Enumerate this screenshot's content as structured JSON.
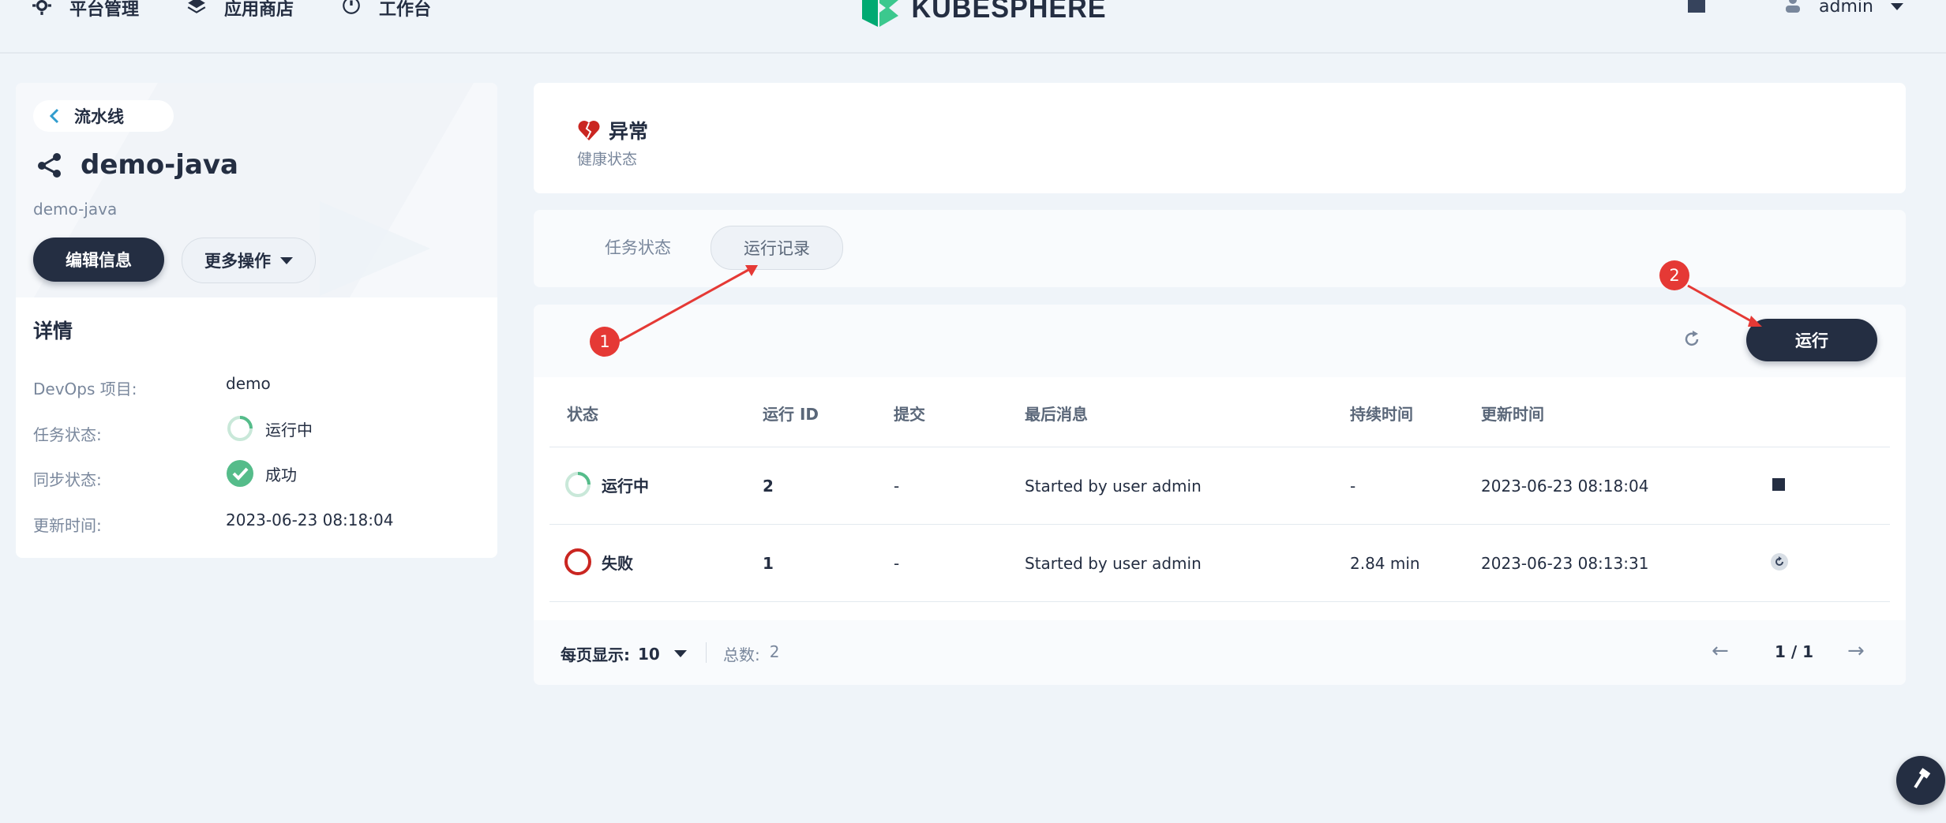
{
  "nav": {
    "platform": "平台管理",
    "appstore": "应用商店",
    "workbench": "工作台",
    "logo": "KUBESPHERE",
    "user": "admin"
  },
  "left": {
    "back_label": "流水线",
    "pipeline_name": "demo-java",
    "pipeline_sub": "demo-java",
    "edit_button": "编辑信息",
    "more_button": "更多操作",
    "details_title": "详情",
    "details": [
      {
        "label": "DevOps 项目:",
        "value": "demo"
      },
      {
        "label": "任务状态:",
        "value": "运行中"
      },
      {
        "label": "同步状态:",
        "value": "成功"
      },
      {
        "label": "更新时间:",
        "value": "2023-06-23 08:18:04"
      }
    ]
  },
  "health": {
    "status": "异常",
    "label": "健康状态"
  },
  "tabs": [
    "任务状态",
    "运行记录"
  ],
  "table": {
    "run_button": "运行",
    "headers": [
      "状态",
      "运行 ID",
      "提交",
      "最后消息",
      "持续时间",
      "更新时间"
    ],
    "rows": [
      {
        "status": "运行中",
        "id": "2",
        "commit": "-",
        "message": "Started by user admin",
        "duration": "-",
        "updated": "2023-06-23 08:18:04",
        "action_icon": "stop-icon"
      },
      {
        "status": "失败",
        "id": "1",
        "commit": "-",
        "message": "Started by user admin",
        "duration": "2.84 min",
        "updated": "2023-06-23 08:13:31",
        "action_icon": "replay-icon"
      }
    ],
    "per_page_label": "每页显示:",
    "per_page_value": "10",
    "total_label": "总数:",
    "total_value": "2",
    "page": "1 / 1"
  },
  "annotations": [
    "1",
    "2"
  ],
  "colors": {
    "primary": "#242e42",
    "success": "#55bc8a",
    "danger": "#ca2621",
    "annotation": "#e53935"
  }
}
